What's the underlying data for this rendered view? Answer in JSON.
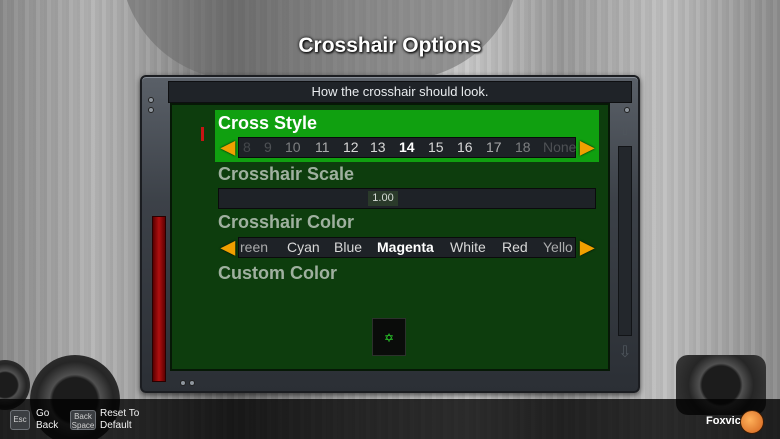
{
  "screen": {
    "title": "Crosshair Options",
    "description": "How the crosshair should look."
  },
  "options": {
    "cross_style": {
      "label": "Cross Style",
      "values": [
        "8",
        "9",
        "10",
        "11",
        "12",
        "13",
        "14",
        "15",
        "16",
        "17",
        "18",
        "None"
      ],
      "selected": "14"
    },
    "crosshair_scale": {
      "label": "Crosshair Scale",
      "value": "1.00"
    },
    "crosshair_color": {
      "label": "Crosshair Color",
      "values": [
        "reen",
        "Cyan",
        "Blue",
        "Magenta",
        "White",
        "Red",
        "Yello"
      ],
      "selected": "Magenta"
    },
    "custom_color": {
      "label": "Custom Color"
    }
  },
  "footer": {
    "back_key": "Esc",
    "back_label_1": "Go",
    "back_label_2": "Back",
    "reset_key_1": "Back",
    "reset_key_2": "Space",
    "reset_label_1": "Reset To",
    "reset_label_2": "Default",
    "username": "Foxvic"
  },
  "colors": {
    "selected_row": "#10a010",
    "panel": "#0d3d0d",
    "arrow": "#f0a000"
  },
  "icons": {
    "left_arrow": "left-arrow-icon",
    "right_arrow": "right-arrow-icon",
    "scroll_up": "scroll-up-icon",
    "scroll_down": "scroll-down-icon"
  }
}
